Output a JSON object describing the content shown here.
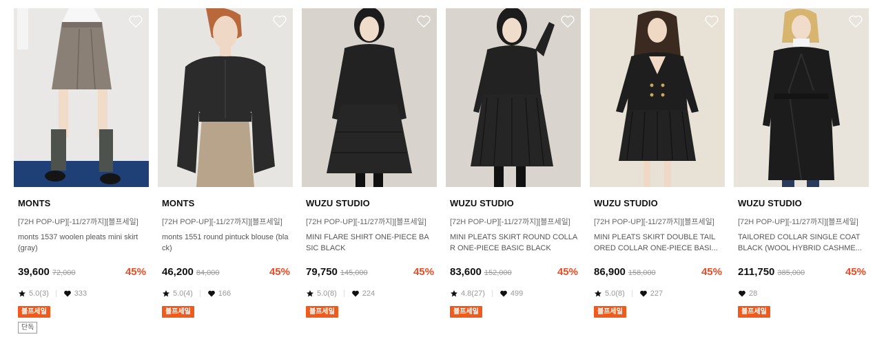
{
  "colors": {
    "accent": "#ef4b23",
    "badge": "#f05a1b"
  },
  "icons": {
    "wishlist": "heart-outline-icon",
    "rating": "star-icon",
    "likes": "heart-filled-icon"
  },
  "products": [
    {
      "brand": "MONTS",
      "tag": "[72H POP-UP][-11/27까지][블프세일]",
      "name": "monts 1537 woolen pleats mini skirt (gray)",
      "price": "39,600",
      "original_price": "72,000",
      "discount": "45%",
      "rating": "5.0(3)",
      "likes": "333",
      "badge": "블프세일",
      "badge2": "단독"
    },
    {
      "brand": "MONTS",
      "tag": "[72H POP-UP][-11/27까지][블프세일]",
      "name": "monts 1551 round pintuck blouse (black)",
      "price": "46,200",
      "original_price": "84,000",
      "discount": "45%",
      "rating": "5.0(4)",
      "likes": "166",
      "badge": "블프세일"
    },
    {
      "brand": "WUZU STUDIO",
      "tag": "[72H POP-UP][-11/27까지][블프세일]",
      "name": "MINI FLARE SHIRT ONE-PIECE BASIC BLACK",
      "price": "79,750",
      "original_price": "145,000",
      "discount": "45%",
      "rating": "5.0(8)",
      "likes": "224",
      "badge": "블프세일"
    },
    {
      "brand": "WUZU STUDIO",
      "tag": "[72H POP-UP][-11/27까지][블프세일]",
      "name": "MINI PLEATS SKIRT ROUND COLLAR ONE-PIECE BASIC BLACK",
      "price": "83,600",
      "original_price": "152,000",
      "discount": "45%",
      "rating": "4.8(27)",
      "likes": "499",
      "badge": "블프세일"
    },
    {
      "brand": "WUZU STUDIO",
      "tag": "[72H POP-UP][-11/27까지][블프세일]",
      "name_line1": "MINI PLEATS SKIRT DOUBLE TAIL",
      "name_line2": "ORED COLLAR ONE-PIECE BASI...",
      "price": "86,900",
      "original_price": "158,000",
      "discount": "45%",
      "rating": "5.0(8)",
      "likes": "227",
      "badge": "블프세일"
    },
    {
      "brand": "WUZU STUDIO",
      "tag": "[72H POP-UP][-11/27까지][블프세일]",
      "name_line1": "TAILORED COLLAR SINGLE COAT",
      "name_line2": "BLACK (WOOL HYBRID CASHME...",
      "price": "211,750",
      "original_price": "385,000",
      "discount": "45%",
      "likes": "28",
      "badge": "블프세일"
    }
  ]
}
